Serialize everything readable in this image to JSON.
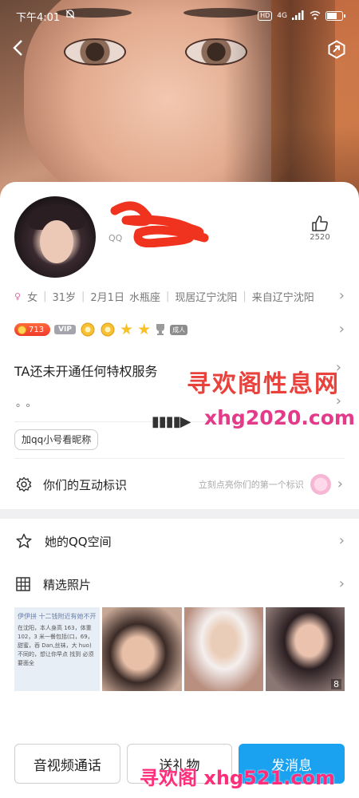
{
  "statusbar": {
    "time": "下午4:01",
    "hd": "HD",
    "signal": "4G"
  },
  "profile": {
    "qq_prefix": "QQ",
    "like_count": "2520",
    "info": {
      "gender": "女",
      "age": "31岁",
      "birthday": "2月1日",
      "zodiac": "水瓶座",
      "location": "现居辽宁沈阳",
      "hometown": "来自辽宁沈阳"
    },
    "badges": {
      "level": "713",
      "vip": "VIP",
      "tag": "成人"
    },
    "service_text": "TA还未开通任何特权服务",
    "signature": "。。",
    "nick_button": "加qq小号看昵称"
  },
  "interact": {
    "label": "你们的互动标识",
    "hint": "立刻点亮你们的第一个标识"
  },
  "qzone": {
    "label": "她的QQ空间"
  },
  "photos": {
    "label": "精选照片",
    "count": "8",
    "p1_top": "伊伊拼 十二钱附近有她不开",
    "p1_text": "在沈阳，本人身高 163，体重 102，3 米一餐包括(口，69，甜蜜，吞 Dan,丝袜，大 huo) 不同的，想让你早点 找到 必须要面全"
  },
  "actions": {
    "call": "音视频通话",
    "gift": "送礼物",
    "message": "发消息"
  },
  "watermark": {
    "title": "寻欢阁性息网",
    "url": "xhg2020.com",
    "bottom": "寻欢阁 xhg521.com"
  },
  "colors": {
    "accent": "#1aa2f0",
    "watermark_red": "#e9423c",
    "watermark_pink": "#e33a8a"
  }
}
